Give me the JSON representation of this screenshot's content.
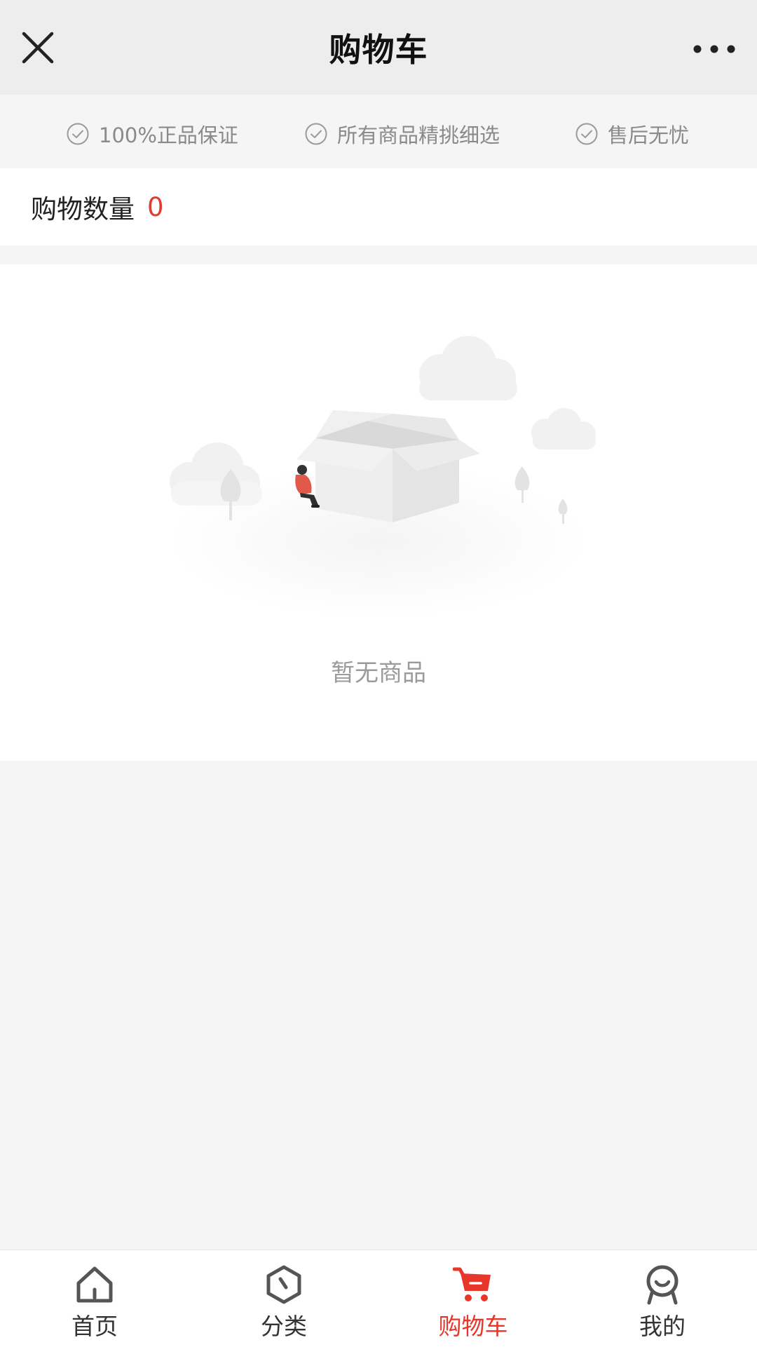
{
  "header": {
    "title": "购物车",
    "close_icon": "close-icon",
    "more_icon": "more-icon"
  },
  "guarantees": [
    {
      "icon": "check-circle-icon",
      "label": "100%正品保证"
    },
    {
      "icon": "check-circle-icon",
      "label": "所有商品精挑细选"
    },
    {
      "icon": "check-circle-icon",
      "label": "售后无忧"
    }
  ],
  "cart": {
    "count_label": "购物数量",
    "count_value": "0"
  },
  "empty_state": {
    "illustration": "empty-box-illustration",
    "text": "暂无商品"
  },
  "tabbar": {
    "items": [
      {
        "icon": "home-icon",
        "label": "首页",
        "active": false
      },
      {
        "icon": "category-icon",
        "label": "分类",
        "active": false
      },
      {
        "icon": "cart-icon",
        "label": "购物车",
        "active": true
      },
      {
        "icon": "profile-icon",
        "label": "我的",
        "active": false
      }
    ]
  },
  "colors": {
    "accent": "#e8372a",
    "background": "#f5f5f5",
    "header_background": "#ededed"
  }
}
